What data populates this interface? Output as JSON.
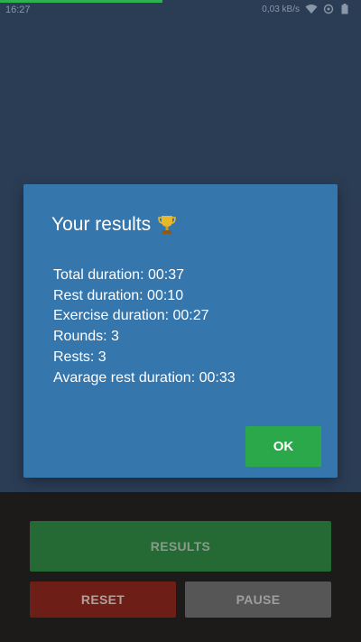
{
  "status_bar": {
    "time": "16:27",
    "network_speed": "0,03 kB/s",
    "icons": [
      "wifi-icon",
      "sync-icon",
      "battery-icon"
    ],
    "progress_fraction": 0.45
  },
  "dialog": {
    "title": "Your results",
    "title_icon": "trophy-icon",
    "results": [
      "Total duration: 00:37",
      "Rest duration: 00:10",
      "Exercise duration: 00:27",
      "Rounds: 3",
      "Rests: 3",
      "Avarage rest duration: 00:33"
    ],
    "ok_label": "OK"
  },
  "controls": {
    "results_label": "RESULTS",
    "reset_label": "RESET",
    "pause_label": "PAUSE"
  },
  "colors": {
    "dialog_bg": "#3576ad",
    "ok_button": "#2aa84a",
    "results_button": "#256935",
    "reset_button": "#6d1e16",
    "pause_button": "#575656"
  }
}
